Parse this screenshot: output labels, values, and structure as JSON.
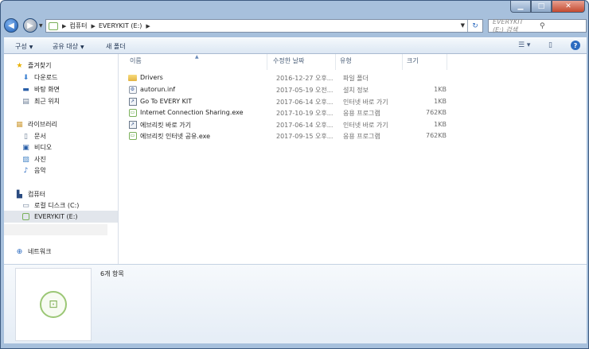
{
  "window": {
    "colors": {
      "frame": "#a7c0dc",
      "close": "#c44a30",
      "accent": "#2d6cc0"
    }
  },
  "address": {
    "crumbs": [
      "컴퓨터",
      "EVERYKIT (E:)"
    ]
  },
  "search": {
    "placeholder": "EVERYKIT (E:) 검색"
  },
  "toolbar": {
    "organize": "구성",
    "share": "공유 대상",
    "new_folder": "새 폴더"
  },
  "sidebar": {
    "favorites": {
      "label": "즐겨찾기",
      "items": [
        "다운로드",
        "바탕 화면",
        "최근 위치"
      ]
    },
    "libraries": {
      "label": "라이브러리",
      "items": [
        "문서",
        "비디오",
        "사진",
        "음악"
      ]
    },
    "computer": {
      "label": "컴퓨터",
      "items": [
        "로컬 디스크 (C:)",
        "EVERYKIT (E:)"
      ]
    },
    "network": {
      "label": "네트워크"
    }
  },
  "columns": {
    "name": "이름",
    "date": "수정한 날짜",
    "type": "유형",
    "size": "크기"
  },
  "files": [
    {
      "icon": "folder-icon",
      "name": "Drivers",
      "date": "2016-12-27 오후...",
      "type": "파일 폴더",
      "size": ""
    },
    {
      "icon": "inf-file-icon",
      "name": "autorun.inf",
      "date": "2017-05-19 오전...",
      "type": "설치 정보",
      "size": "1KB"
    },
    {
      "icon": "shortcut-icon",
      "name": "Go To EVERY KIT",
      "date": "2017-06-14 오후...",
      "type": "인터넷 바로 가기",
      "size": "1KB"
    },
    {
      "icon": "exe-icon",
      "name": "Internet Connection Sharing.exe",
      "date": "2017-10-19 오후...",
      "type": "응용 프로그램",
      "size": "762KB"
    },
    {
      "icon": "shortcut-icon",
      "name": "에브리킷 바로 가기",
      "date": "2017-06-14 오후...",
      "type": "인터넷 바로 가기",
      "size": "1KB"
    },
    {
      "icon": "exe-icon",
      "name": "에브리킷 인터넷 공유.exe",
      "date": "2017-09-15 오후...",
      "type": "응용 프로그램",
      "size": "762KB"
    }
  ],
  "details": {
    "count": "6개 항목"
  }
}
